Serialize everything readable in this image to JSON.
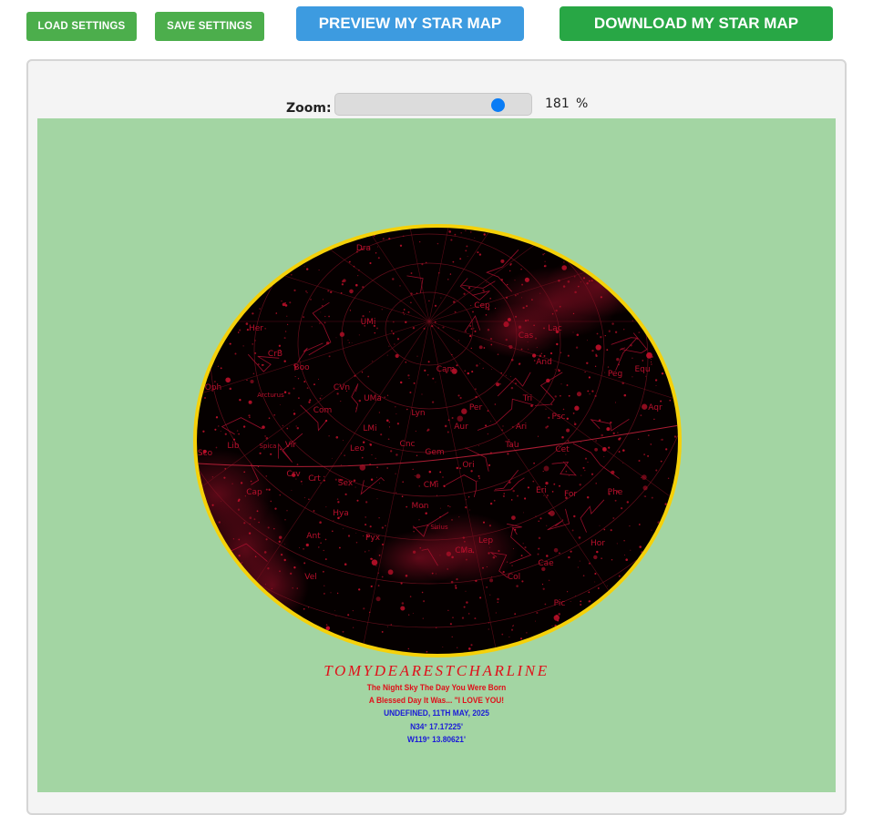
{
  "toolbar": {
    "load_label": "LOAD SETTINGS",
    "save_label": "SAVE SETTINGS",
    "preview_label": "PREVIEW MY STAR MAP",
    "download_label": "DOWNLOAD MY STAR MAP"
  },
  "zoom": {
    "label": "Zoom:",
    "value": "181",
    "unit": "%",
    "slider_fraction": 0.82
  },
  "colors": {
    "background": "#a3d5a3",
    "ring": "#f5d10a",
    "sky": "#050000",
    "star": "#c0102a",
    "line": "#7a1020"
  },
  "constellations": [
    "Dra",
    "Cep",
    "UMi",
    "Her",
    "Cas",
    "Lac",
    "CrB",
    "Boo",
    "And",
    "Peg",
    "Equ",
    "Oph",
    "Arcturus",
    "CVn",
    "Cam",
    "UMa",
    "Tri",
    "Aqr",
    "Psc",
    "Com",
    "Lyn",
    "Per",
    "Ari",
    "Aur",
    "LMi",
    "Leo",
    "Cnc",
    "Gem",
    "Tau",
    "Cet",
    "Sco",
    "Lib",
    "Spica",
    "Vir",
    "Ori",
    "Crv",
    "Crt",
    "Sex",
    "CMi",
    "Eri",
    "For",
    "Cap",
    "Hya",
    "Mon",
    "Phe",
    "Ant",
    "Pyx",
    "Lep",
    "Sirius",
    "CMa",
    "Hor",
    "Vel",
    "Col",
    "Cae",
    "Pic"
  ],
  "caption": {
    "title": "TOMYDEARESTCHARLINE",
    "line1": "The Night Sky The Day You Were Born",
    "line2": "A Blessed Day It Was... \"I LOVE YOU!",
    "line3": "UNDEFINED, 11TH MAY, 2025",
    "line4": "N34° 17.17225'",
    "line5": "W119° 13.80621'"
  }
}
